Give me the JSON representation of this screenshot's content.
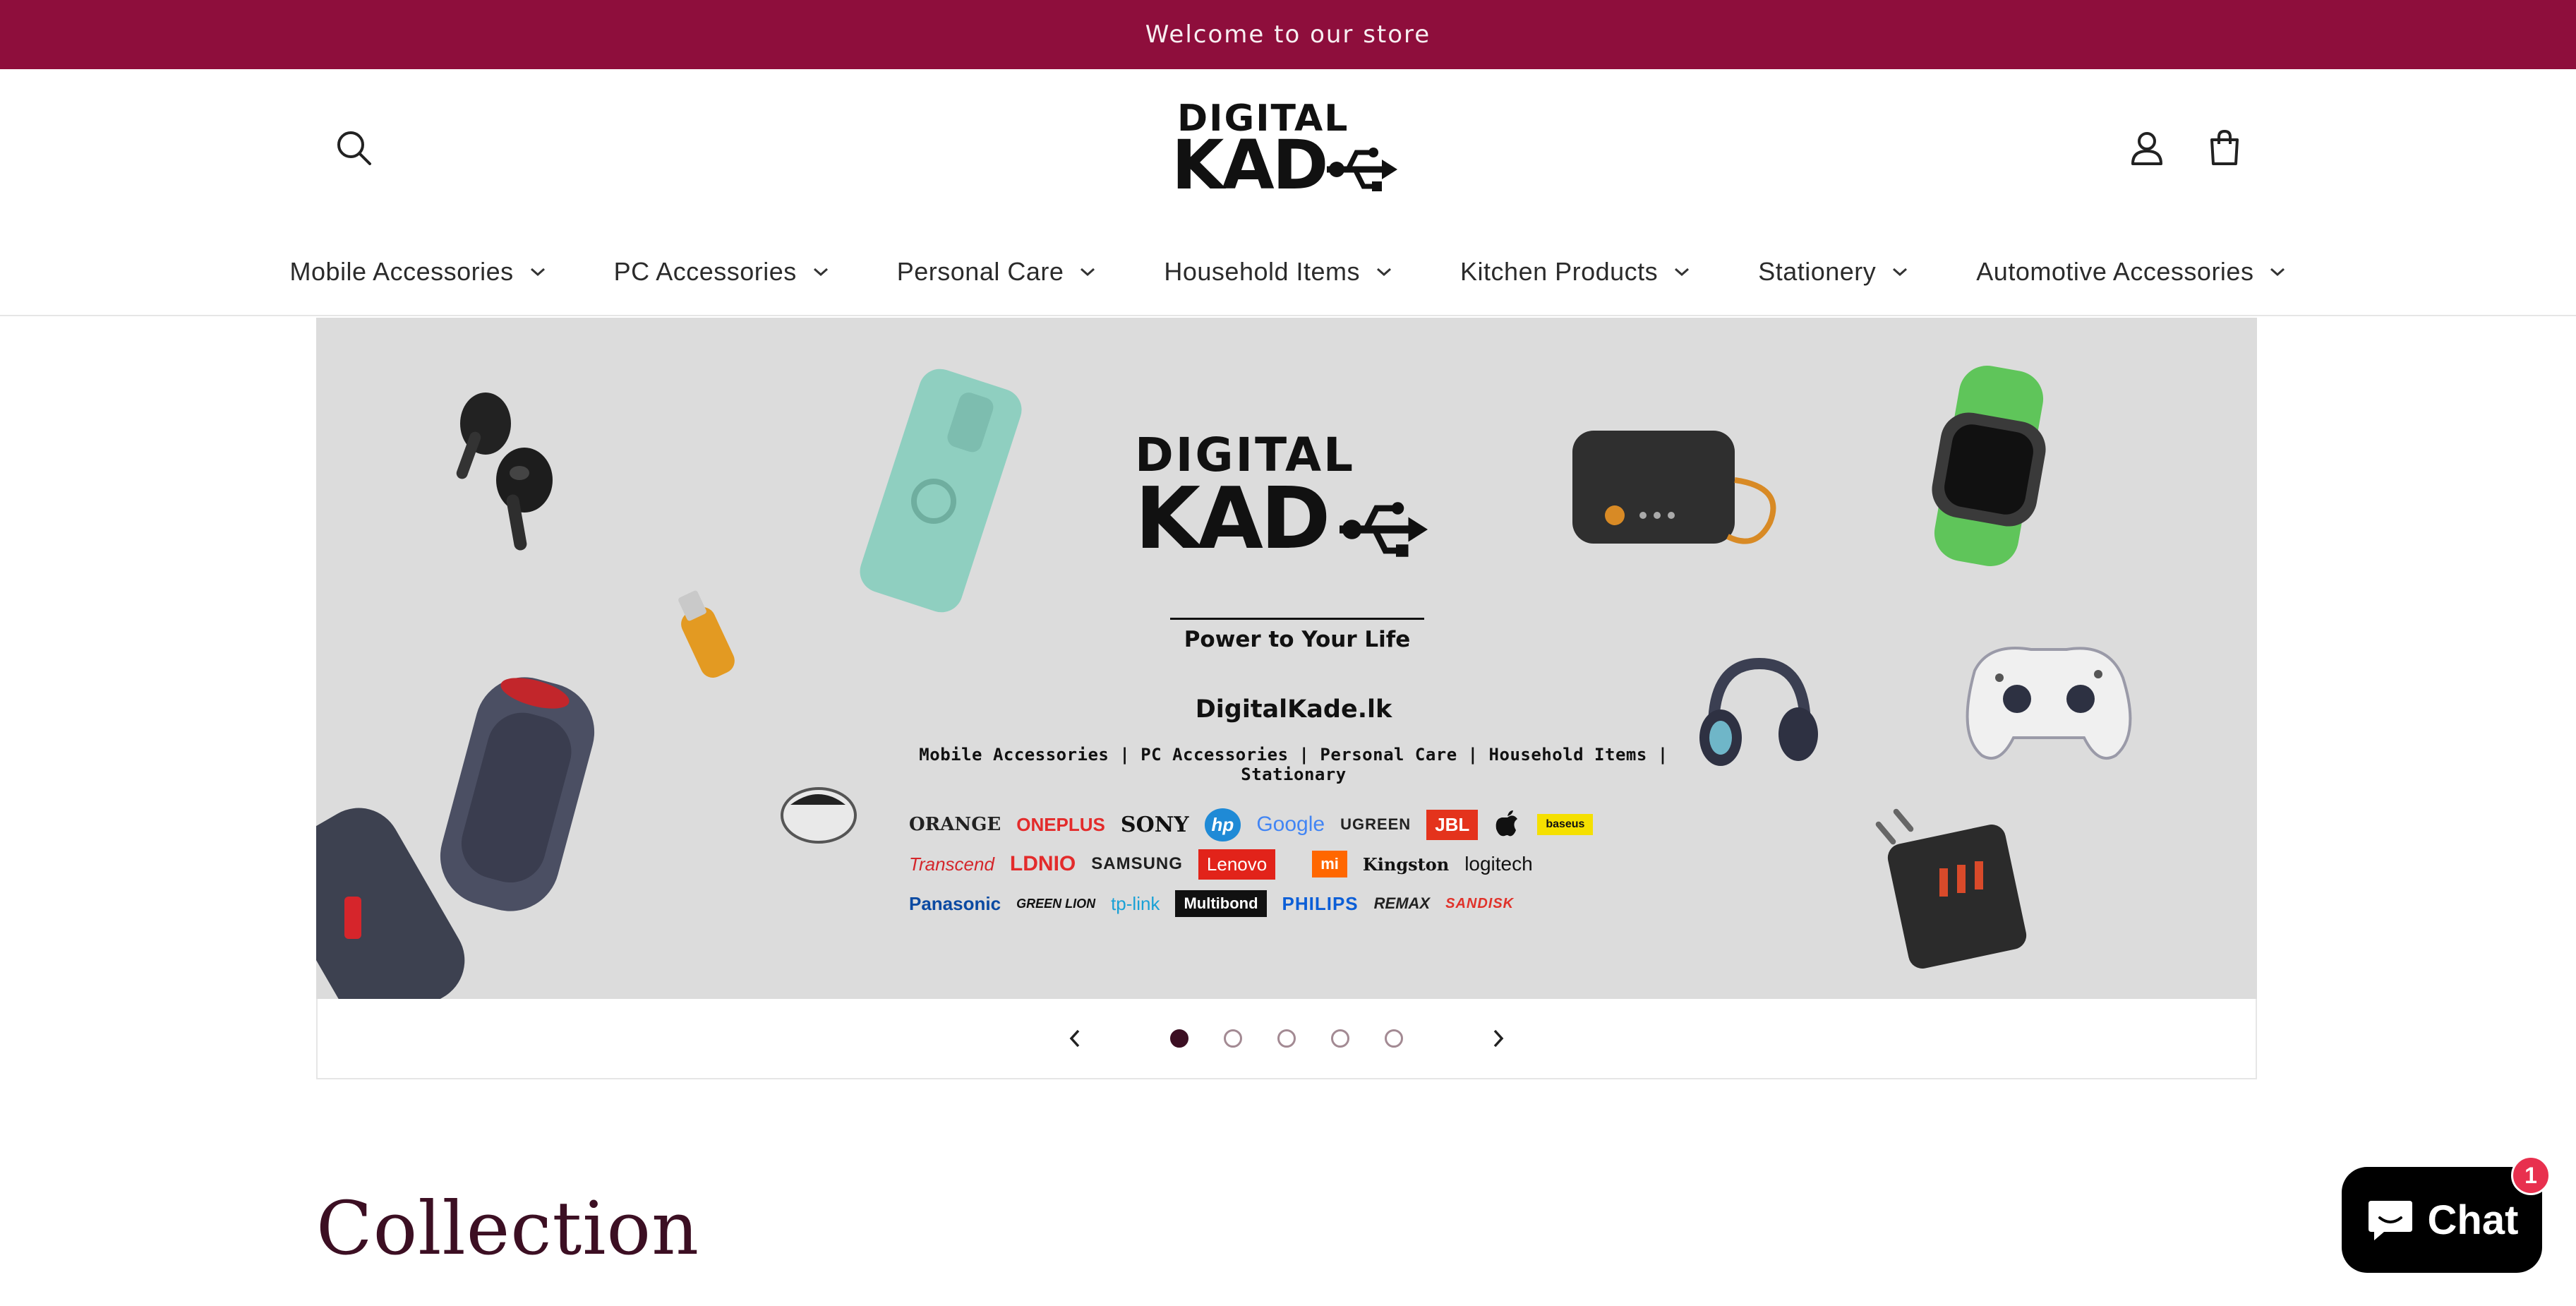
{
  "announcement": {
    "text": "Welcome to our store"
  },
  "header": {
    "logo": {
      "line1": "DIGITAL",
      "line2": "KAD"
    },
    "icons": {
      "search": "search-icon",
      "account": "user-icon",
      "cart": "cart-icon"
    }
  },
  "nav": {
    "items": [
      {
        "label": "Mobile Accessories"
      },
      {
        "label": "PC Accessories"
      },
      {
        "label": "Personal Care"
      },
      {
        "label": "Household Items"
      },
      {
        "label": "Kitchen Products"
      },
      {
        "label": "Stationery"
      },
      {
        "label": "Automotive Accessories"
      }
    ]
  },
  "banner": {
    "logo": {
      "line1": "DIGITAL",
      "line2": "KAD"
    },
    "tagline": "Power to Your Life",
    "site": "DigitalKade.lk",
    "categories": "Mobile Accessories | PC Accessories | Personal Care | Household Items | Stationary",
    "brands": {
      "row1": [
        "ORANGE",
        "ONEPLUS",
        "SONY",
        "hp",
        "Google",
        "UGREEN",
        "JBL",
        "",
        "baseus"
      ],
      "row2": [
        "Transcend",
        "LDNIO",
        "SAMSUNG",
        "Lenovo",
        "mi",
        "Kingston",
        "logitech"
      ],
      "row3": [
        "Panasonic",
        "GREEN LION",
        "tp-link",
        "Multibond",
        "PHILIPS",
        "REMAX",
        "SANDISK"
      ]
    }
  },
  "slider": {
    "slide_count": 5,
    "active_index": 0
  },
  "collection": {
    "title": "Collection"
  },
  "chat": {
    "label": "Chat",
    "badge": "1"
  },
  "colors": {
    "announcement_bg": "#8e0e3c",
    "heading": "#3c0f23",
    "chat_badge": "#e8304e"
  }
}
